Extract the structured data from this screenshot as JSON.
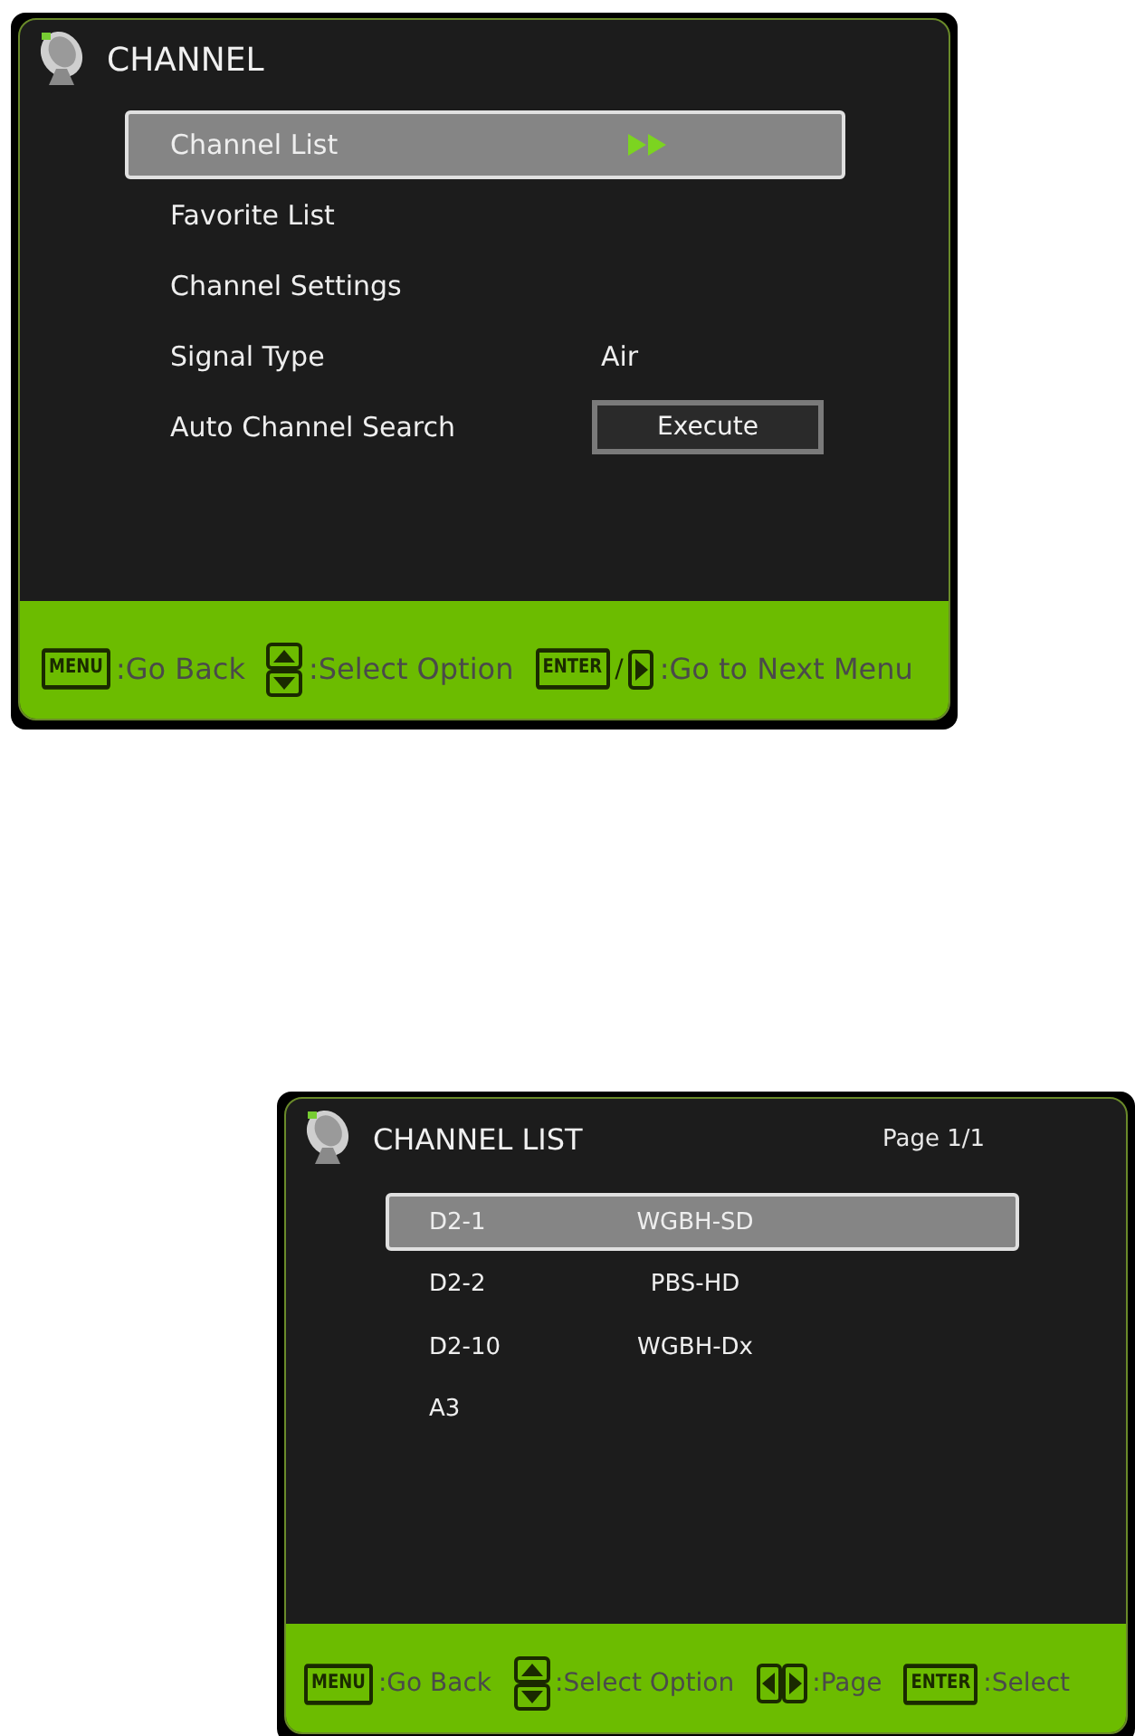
{
  "screens": [
    {
      "title": "CHANNEL",
      "items": [
        {
          "kind": "submenu",
          "label": "Channel List",
          "selected": true
        },
        {
          "kind": "plain",
          "label": "Favorite List",
          "selected": false
        },
        {
          "kind": "plain",
          "label": "Channel Settings",
          "selected": false
        },
        {
          "kind": "value",
          "label": "Signal Type",
          "value": "Air",
          "selected": false
        },
        {
          "kind": "button",
          "label": "Auto Channel Search",
          "button": "Execute",
          "selected": false
        }
      ],
      "hints": [
        {
          "keys": [
            {
              "kind": "key",
              "text": "MENU"
            }
          ],
          "text": ":Go Back"
        },
        {
          "keys": [
            {
              "kind": "updown"
            }
          ],
          "text": ":Select Option"
        },
        {
          "keys": [
            {
              "kind": "key",
              "text": "ENTER"
            },
            {
              "kind": "slash",
              "text": "/"
            },
            {
              "kind": "right"
            }
          ],
          "text": ":Go to Next Menu"
        }
      ]
    },
    {
      "title": "CHANNEL LIST",
      "page": "Page 1/1",
      "items": [
        {
          "kind": "channel",
          "label": "D2-1",
          "value": "WGBH-SD",
          "selected": true
        },
        {
          "kind": "channel",
          "label": "D2-2",
          "value": "PBS-HD",
          "selected": false
        },
        {
          "kind": "channel",
          "label": "D2-10",
          "value": "WGBH-Dx",
          "selected": false
        },
        {
          "kind": "channel",
          "label": "A3",
          "selected": false
        }
      ],
      "hints": [
        {
          "keys": [
            {
              "kind": "key",
              "text": "MENU"
            }
          ],
          "text": ":Go Back"
        },
        {
          "keys": [
            {
              "kind": "updown"
            }
          ],
          "text": ":Select Option"
        },
        {
          "keys": [
            {
              "kind": "leftright"
            }
          ],
          "text": ":Page"
        },
        {
          "keys": [
            {
              "kind": "key",
              "text": "ENTER"
            }
          ],
          "text": ":Select"
        }
      ]
    }
  ]
}
